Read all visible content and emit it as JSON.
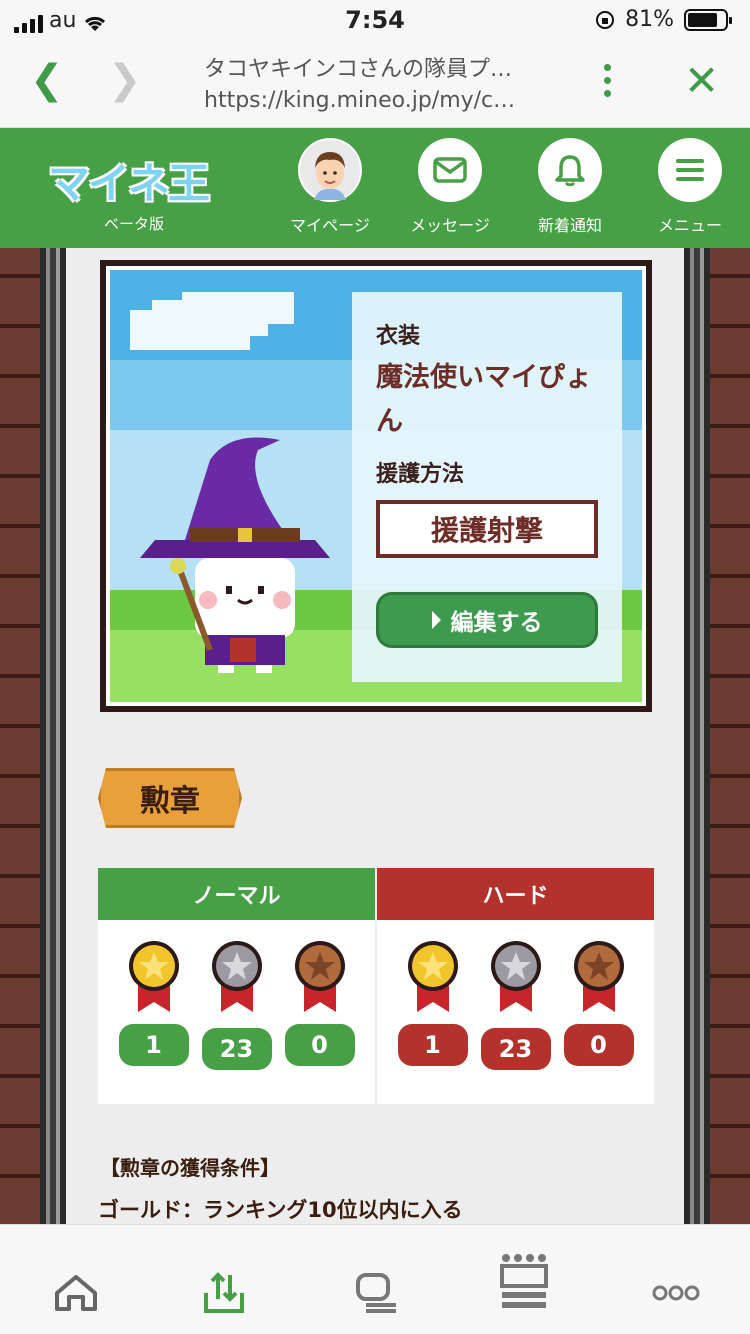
{
  "status": {
    "carrier": "au",
    "time": "7:54",
    "battery": "81%",
    "battery_level": 0.81
  },
  "browser": {
    "title": "タコヤキインコさんの隊員プ…",
    "url": "https://king.mineo.jp/my/c…"
  },
  "header": {
    "logo": "マイネ王",
    "beta": "ベータ版",
    "nav": [
      {
        "label": "マイページ",
        "icon": "avatar-icon"
      },
      {
        "label": "メッセージ",
        "icon": "envelope-icon"
      },
      {
        "label": "新着通知",
        "icon": "bell-icon"
      },
      {
        "label": "メニュー",
        "icon": "hamburger-icon"
      }
    ]
  },
  "costume": {
    "costume_label": "衣装",
    "costume_name": "魔法使いマイぴょん",
    "support_label": "援護方法",
    "support_value": "援護射撃",
    "edit_button": "編集する"
  },
  "medals": {
    "title": "勲章",
    "normal": {
      "label": "ノーマル",
      "gold": "1",
      "silver": "23",
      "bronze": "0"
    },
    "hard": {
      "label": "ハード",
      "gold": "1",
      "silver": "23",
      "bronze": "0"
    }
  },
  "conditions": {
    "title": "【勲章の獲得条件】",
    "gold": "ゴールド：ランキング10位以内に入る"
  },
  "colors": {
    "brand_green": "#47a046",
    "hard_red": "#b3332c",
    "ribbon": "#e8a03a",
    "text_brown": "#6d2d27"
  }
}
